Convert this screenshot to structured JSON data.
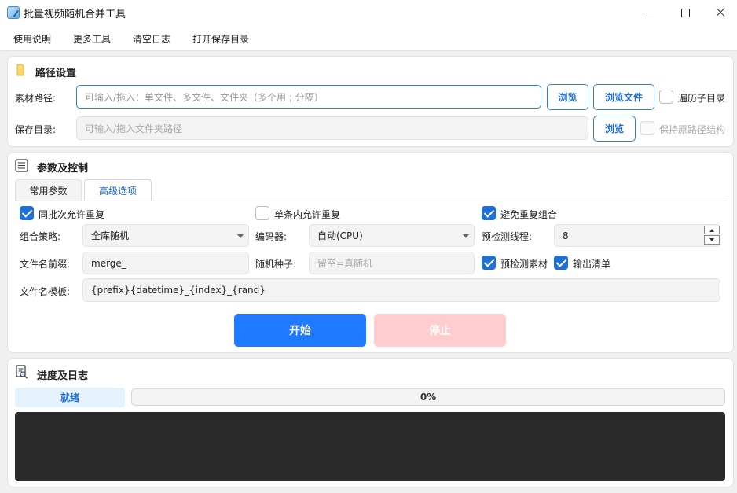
{
  "window": {
    "title": "批量视频随机合并工具"
  },
  "menu": [
    "使用说明",
    "更多工具",
    "清空日志",
    "打开保存目录"
  ],
  "path_section": {
    "title": "路径设置",
    "source_label": "素材路径:",
    "source_placeholder": "可输入/拖入：单文件、多文件、文件夹（多个用 ; 分隔）",
    "browse_label": "浏览",
    "browse_files_label": "浏览文件",
    "recurse_label": "遍历子目录",
    "recurse_checked": false,
    "save_label": "保存目录:",
    "save_placeholder": "可输入/拖入文件夹路径",
    "save_browse_label": "浏览",
    "keep_structure_label": "保持原路径结构",
    "keep_structure_checked": false
  },
  "params_section": {
    "title": "参数及控制",
    "tabs": [
      {
        "label": "常用参数",
        "active": false
      },
      {
        "label": "高级选项",
        "active": true
      }
    ],
    "allow_repeat_batch": {
      "label": "同批次允许重复",
      "checked": true
    },
    "allow_repeat_single": {
      "label": "单条内允许重复",
      "checked": false
    },
    "avoid_repeat_combo": {
      "label": "避免重复组合",
      "checked": true
    },
    "strategy_label": "组合策略:",
    "strategy_value": "全库随机",
    "encoder_label": "编码器:",
    "encoder_value": "自动(CPU)",
    "precheck_threads_label": "预检测线程:",
    "precheck_threads_value": "8",
    "prefix_label": "文件名前缀:",
    "prefix_value": "merge_",
    "seed_label": "随机种子:",
    "seed_placeholder": "留空=真随机",
    "precheck_material": {
      "label": "预检测素材",
      "checked": true
    },
    "output_list": {
      "label": "输出清单",
      "checked": true
    },
    "template_label": "文件名模板:",
    "template_value": "{prefix}{datetime}_{index}_{rand}",
    "start_label": "开始",
    "stop_label": "停止"
  },
  "progress_section": {
    "title": "进度及日志",
    "status": "就绪",
    "progress_text": "0%",
    "progress": 0
  },
  "colors": {
    "accent": "#1f7aff",
    "stop_disabled": "#ffcdcd",
    "log_bg": "#2b2b2b",
    "status_bg": "#e3f2fd"
  },
  "icons": {
    "folder": "folder-icon",
    "list": "list-icon",
    "search_doc": "search-doc-icon"
  }
}
